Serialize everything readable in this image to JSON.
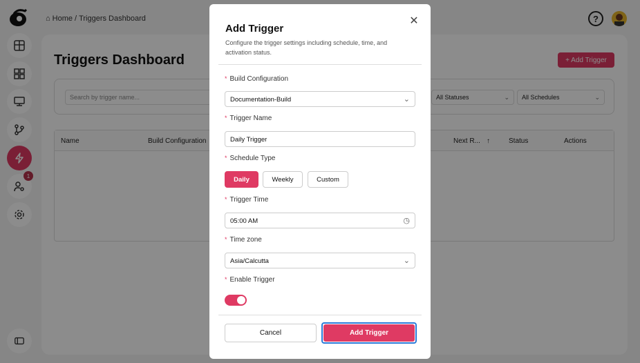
{
  "breadcrumb": {
    "home": "Home",
    "separator": "/",
    "current": "Triggers Dashboard"
  },
  "page": {
    "title": "Triggers Dashboard",
    "add_button": "+ Add Trigger"
  },
  "filters": {
    "search_placeholder": "Search by trigger name...",
    "status": "All Statuses",
    "schedule": "All Schedules"
  },
  "table": {
    "columns": [
      "Name",
      "Build Configuration",
      "Next R...",
      "Status",
      "Actions"
    ]
  },
  "nav": {
    "badge_count": "1"
  },
  "modal": {
    "title": "Add Trigger",
    "description": "Configure the trigger settings including schedule, time, and activation status.",
    "required_mark": "*",
    "build_config_label": "Build Configuration",
    "build_config_value": "Documentation-Build",
    "trigger_name_label": "Trigger Name",
    "trigger_name_value": "Daily Trigger",
    "schedule_type_label": "Schedule Type",
    "schedule_options": [
      "Daily",
      "Weekly",
      "Custom"
    ],
    "schedule_selected": "Daily",
    "trigger_time_label": "Trigger Time",
    "trigger_time_value": "05:00 AM",
    "timezone_label": "Time zone",
    "timezone_value": "Asia/Calcutta",
    "enable_label": "Enable Trigger",
    "enable_value": true,
    "cancel_label": "Cancel",
    "submit_label": "Add Trigger"
  },
  "colors": {
    "accent": "#df3a63",
    "focus": "#2a7ad8"
  }
}
